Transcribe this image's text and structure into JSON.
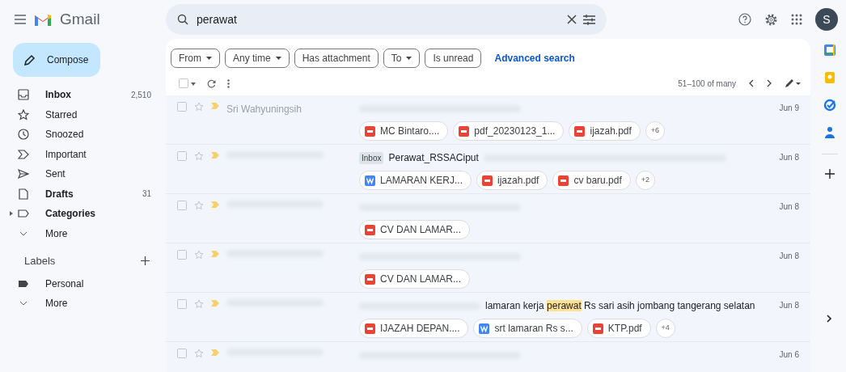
{
  "app": {
    "name": "Gmail"
  },
  "search": {
    "value": "perawat"
  },
  "compose": {
    "label": "Compose"
  },
  "sidebar": {
    "items": [
      {
        "label": "Inbox",
        "count": "2,510",
        "bold": true
      },
      {
        "label": "Starred",
        "bold": false
      },
      {
        "label": "Snoozed",
        "bold": false
      },
      {
        "label": "Important",
        "bold": false
      },
      {
        "label": "Sent",
        "bold": false
      },
      {
        "label": "Drafts",
        "count": "31",
        "bold": true
      },
      {
        "label": "Categories",
        "bold": true,
        "expandable": true
      },
      {
        "label": "More",
        "bold": false
      }
    ],
    "labels_header": "Labels",
    "labels": [
      {
        "label": "Personal"
      },
      {
        "label": "More"
      }
    ]
  },
  "select_all": {
    "checked": false
  },
  "filters": [
    {
      "label": "From",
      "kind": "dropdown"
    },
    {
      "label": "Any time",
      "kind": "dropdown"
    },
    {
      "label": "Has attachment",
      "kind": "chip"
    },
    {
      "label": "To",
      "kind": "dropdown"
    },
    {
      "label": "Is unread",
      "kind": "chip"
    }
  ],
  "advanced_search": "Advanced search",
  "pagination": "51–100 of many",
  "rows": [
    {
      "checked": false,
      "sender": "Sri Wahyuningsih",
      "important": true,
      "date": "Jun 9",
      "attachments": [
        {
          "kind": "pdf",
          "name": "MC Bintaro...."
        },
        {
          "kind": "pdf",
          "name": "pdf_20230123_1..."
        },
        {
          "kind": "pdf",
          "name": "ijazah.pdf"
        }
      ],
      "more": "+6"
    },
    {
      "checked": false,
      "important": true,
      "tag": "Inbox",
      "subject": "Perawat_RSSACiput",
      "date": "Jun 8",
      "attachments": [
        {
          "kind": "word",
          "name": "LAMARAN KERJ..."
        },
        {
          "kind": "pdf",
          "name": "ijazah.pdf"
        },
        {
          "kind": "pdf",
          "name": "cv baru.pdf"
        }
      ],
      "more": "+2"
    },
    {
      "checked": false,
      "important": true,
      "date": "Jun 8",
      "attachments": [
        {
          "kind": "pdf",
          "name": "CV DAN LAMAR..."
        }
      ]
    },
    {
      "checked": false,
      "important": true,
      "date": "Jun 8",
      "attachments": [
        {
          "kind": "pdf",
          "name": "CV DAN LAMAR..."
        }
      ]
    },
    {
      "checked": false,
      "important": true,
      "snippet": "lamaran kerja",
      "highlight": "perawat",
      "snippet_after": "Rs sari asih jombang tangerang selatan",
      "date": "Jun 8",
      "attachments": [
        {
          "kind": "pdf",
          "name": "IJAZAH DEPAN...."
        },
        {
          "kind": "word",
          "name": "srt lamaran Rs s..."
        },
        {
          "kind": "pdf",
          "name": "KTP.pdf"
        }
      ],
      "more": "+4"
    },
    {
      "checked": false,
      "important": true,
      "date": "Jun 6",
      "attachments": []
    }
  ],
  "avatar": "S"
}
